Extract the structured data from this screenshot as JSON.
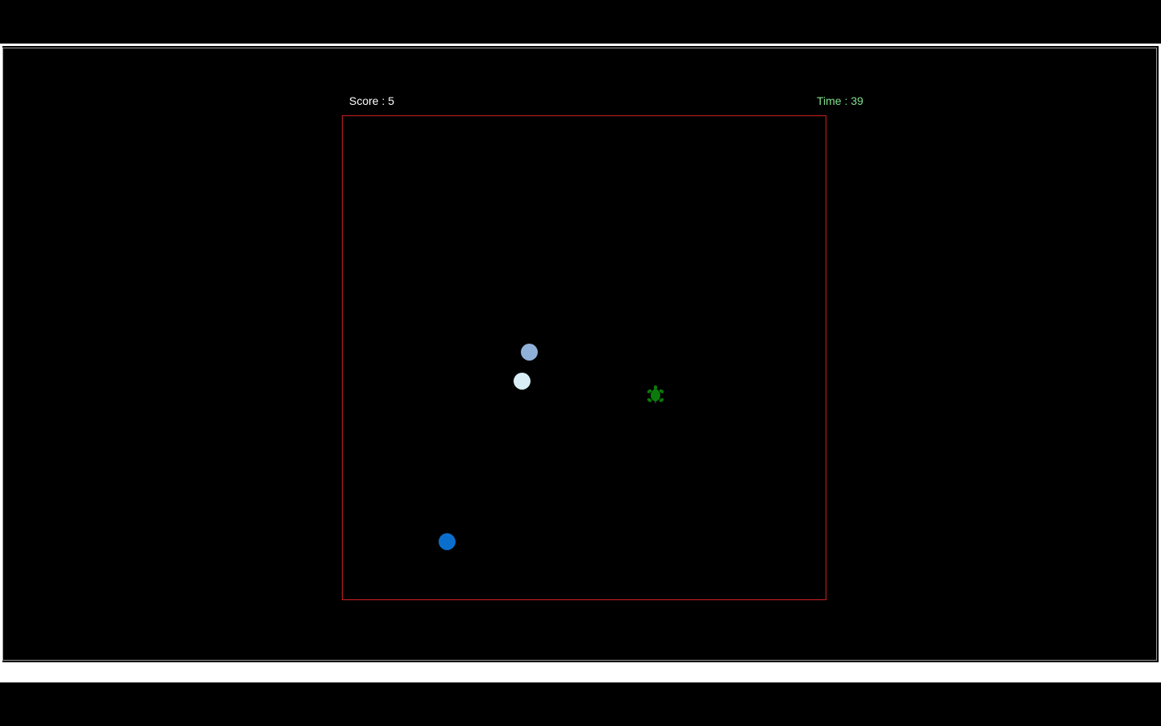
{
  "hud": {
    "score_label": "Score : 5",
    "time_label": "Time : 39"
  },
  "colors": {
    "background": "#000000",
    "score_text": "#ffffff",
    "time_text": "#7fe08a",
    "arena_border": "#cc1f1f",
    "player": "#0b7a0b"
  },
  "entities": {
    "player": {
      "icon": "turtle-icon"
    },
    "balls": [
      {
        "color": "#8fb1d9"
      },
      {
        "color": "#d8eef4"
      },
      {
        "color": "#0a6fcc"
      }
    ]
  }
}
